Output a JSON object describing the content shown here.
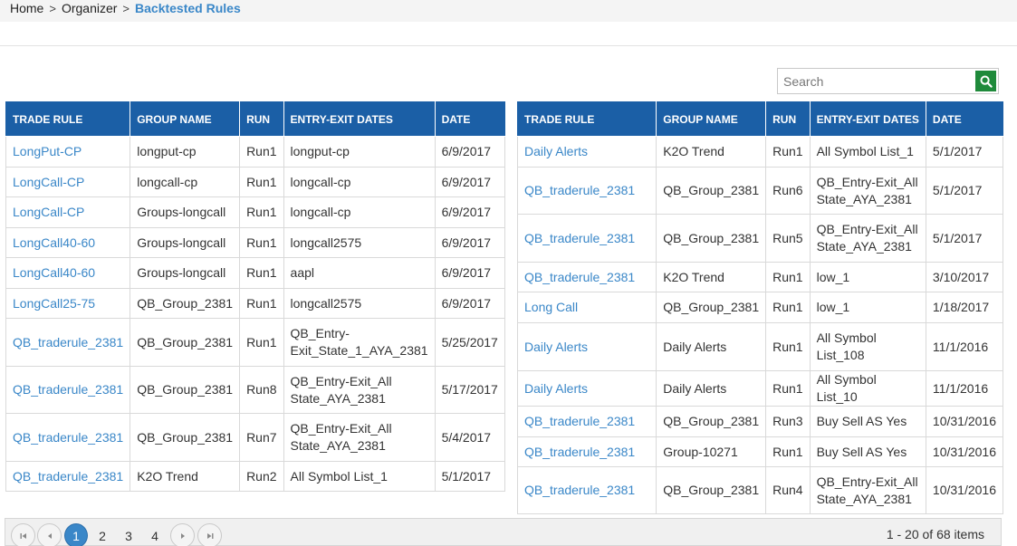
{
  "breadcrumb": {
    "home": "Home",
    "organizer": "Organizer",
    "current": "Backtested Rules",
    "separator": ">"
  },
  "search": {
    "placeholder": "Search",
    "value": "",
    "icon": "search-icon"
  },
  "columns": [
    "TRADE RULE",
    "GROUP NAME",
    "RUN",
    "ENTRY-EXIT DATES",
    "DATE"
  ],
  "left_rows": [
    {
      "rule": "LongPut-CP",
      "group": "longput-cp",
      "run": "Run1",
      "entry": "longput-cp",
      "date": "6/9/2017"
    },
    {
      "rule": "LongCall-CP",
      "group": "longcall-cp",
      "run": "Run1",
      "entry": "longcall-cp",
      "date": "6/9/2017"
    },
    {
      "rule": "LongCall-CP",
      "group": "Groups-longcall",
      "run": "Run1",
      "entry": "longcall-cp",
      "date": "6/9/2017"
    },
    {
      "rule": "LongCall40-60",
      "group": "Groups-longcall",
      "run": "Run1",
      "entry": "longcall2575",
      "date": "6/9/2017"
    },
    {
      "rule": "LongCall40-60",
      "group": "Groups-longcall",
      "run": "Run1",
      "entry": "aapl",
      "date": "6/9/2017"
    },
    {
      "rule": "LongCall25-75",
      "group": "QB_Group_2381",
      "run": "Run1",
      "entry": "longcall2575",
      "date": "6/9/2017"
    },
    {
      "rule": "QB_traderule_2381",
      "group": "QB_Group_2381",
      "run": "Run1",
      "entry": "QB_Entry-Exit_State_1_AYA_2381",
      "date": "5/25/2017"
    },
    {
      "rule": "QB_traderule_2381",
      "group": "QB_Group_2381",
      "run": "Run8",
      "entry": "QB_Entry-Exit_All State_AYA_2381",
      "date": "5/17/2017"
    },
    {
      "rule": "QB_traderule_2381",
      "group": "QB_Group_2381",
      "run": "Run7",
      "entry": "QB_Entry-Exit_All State_AYA_2381",
      "date": "5/4/2017"
    },
    {
      "rule": "QB_traderule_2381",
      "group": "K2O Trend",
      "run": "Run2",
      "entry": "All Symbol List_1",
      "date": "5/1/2017"
    }
  ],
  "right_rows": [
    {
      "rule": "Daily Alerts",
      "group": "K2O Trend",
      "run": "Run1",
      "entry": "All Symbol List_1",
      "date": "5/1/2017"
    },
    {
      "rule": "QB_traderule_2381",
      "group": "QB_Group_2381",
      "run": "Run6",
      "entry": "QB_Entry-Exit_All State_AYA_2381",
      "date": "5/1/2017"
    },
    {
      "rule": "QB_traderule_2381",
      "group": "QB_Group_2381",
      "run": "Run5",
      "entry": "QB_Entry-Exit_All State_AYA_2381",
      "date": "5/1/2017"
    },
    {
      "rule": "QB_traderule_2381",
      "group": "K2O Trend",
      "run": "Run1",
      "entry": "low_1",
      "date": "3/10/2017"
    },
    {
      "rule": "Long Call",
      "group": "QB_Group_2381",
      "run": "Run1",
      "entry": "low_1",
      "date": "1/18/2017"
    },
    {
      "rule": "Daily Alerts",
      "group": "Daily Alerts",
      "run": "Run1",
      "entry": "All Symbol List_108",
      "date": "11/1/2016"
    },
    {
      "rule": "Daily Alerts",
      "group": "Daily Alerts",
      "run": "Run1",
      "entry": "All Symbol List_10",
      "date": "11/1/2016"
    },
    {
      "rule": "QB_traderule_2381",
      "group": "QB_Group_2381",
      "run": "Run3",
      "entry": "Buy Sell AS Yes",
      "date": "10/31/2016"
    },
    {
      "rule": "QB_traderule_2381",
      "group": "Group-10271",
      "run": "Run1",
      "entry": "Buy Sell AS Yes",
      "date": "10/31/2016"
    },
    {
      "rule": "QB_traderule_2381",
      "group": "QB_Group_2381",
      "run": "Run4",
      "entry": "QB_Entry-Exit_All State_AYA_2381",
      "date": "10/31/2016"
    }
  ],
  "pager": {
    "pages": [
      "1",
      "2",
      "3",
      "4"
    ],
    "current_page": "1",
    "first_icon": "first-page-icon",
    "prev_icon": "prev-page-icon",
    "next_icon": "next-page-icon",
    "last_icon": "last-page-icon",
    "info": "1 - 20 of 68 items"
  },
  "colors": {
    "header_bg": "#1b5fa6",
    "link": "#3a87c8",
    "search_button": "#1f8a3b",
    "active_page": "#3a87c8"
  }
}
